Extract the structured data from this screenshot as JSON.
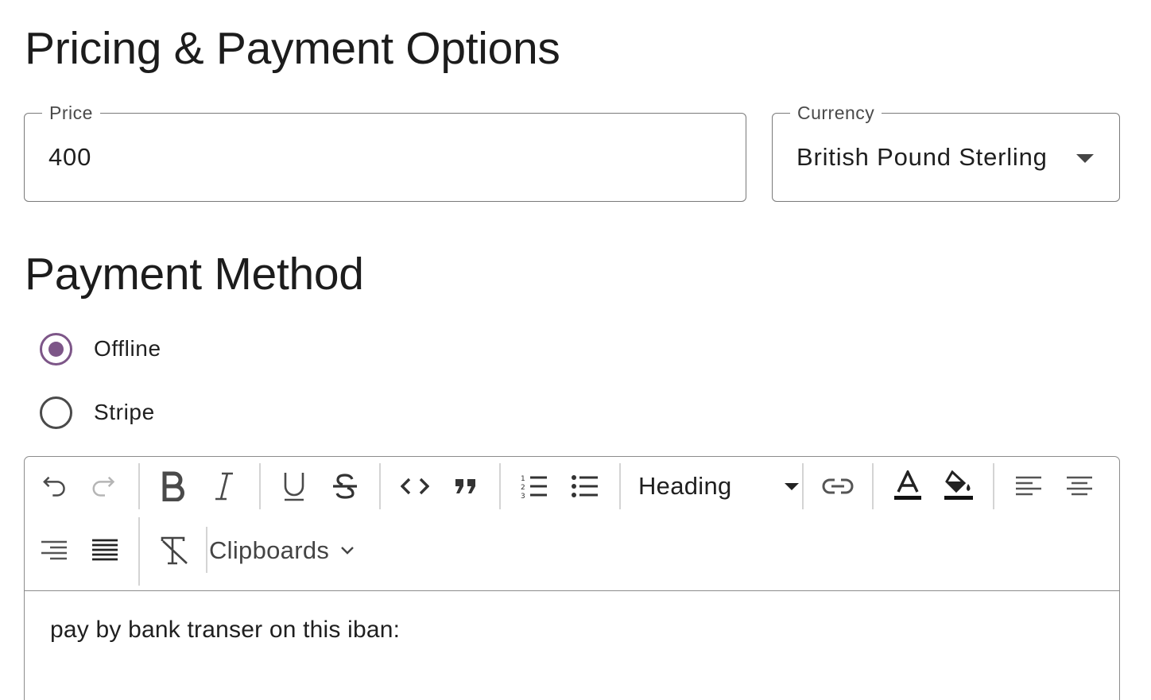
{
  "pricing": {
    "title": "Pricing & Payment Options",
    "price": {
      "label": "Price",
      "value": "400"
    },
    "currency": {
      "label": "Currency",
      "value": "British Pound Sterling"
    }
  },
  "payment_method": {
    "title": "Payment Method",
    "options": [
      {
        "label": "Offline",
        "checked": true
      },
      {
        "label": "Stripe",
        "checked": false
      }
    ]
  },
  "editor": {
    "toolbar": {
      "heading_label": "Heading",
      "clipboards_label": "Clipboards",
      "buttons": [
        "undo-icon",
        "redo-icon",
        "bold-icon",
        "italic-icon",
        "underline-icon",
        "strikethrough-icon",
        "code-icon",
        "blockquote-icon",
        "ordered-list-icon",
        "bullet-list-icon",
        "link-icon",
        "text-color-icon",
        "highlight-color-icon",
        "align-left-icon",
        "align-center-icon",
        "align-right-icon",
        "align-justify-icon",
        "clear-format-icon",
        "chevron-down-icon"
      ]
    },
    "content": "pay by bank transer on this iban:"
  },
  "colors": {
    "accent": "#7d5688",
    "border": "#7a7a7a",
    "text": "#1f1f1f"
  }
}
